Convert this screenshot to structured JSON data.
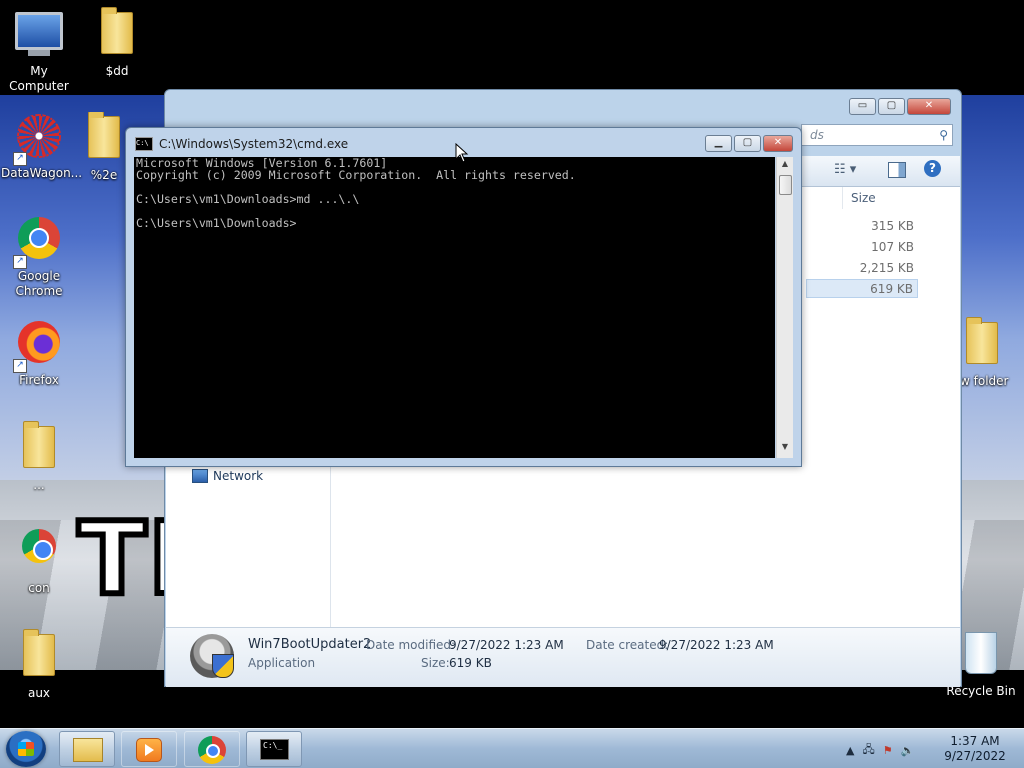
{
  "desktop": {
    "icons": [
      {
        "label": "My Computer"
      },
      {
        "label": "$dd"
      },
      {
        "label": "DataWagon..."
      },
      {
        "label": "%2e"
      },
      {
        "label": "Google Chrome"
      },
      {
        "label": "Firefox"
      },
      {
        "label": "..."
      },
      {
        "label": "con"
      },
      {
        "label": "aux"
      },
      {
        "label": "w folder"
      },
      {
        "label": "Recycle Bin"
      }
    ],
    "wallpaper_text": "TI"
  },
  "explorer": {
    "search_placeholder": "ds",
    "caption": {
      "minimize": "▭",
      "maximize": "▢",
      "close": "✕"
    },
    "size_column_header": "Size",
    "sizes": [
      "315 KB",
      "107 KB",
      "2,215 KB",
      "619 KB"
    ],
    "nav_network": "Network",
    "details": {
      "name": "Win7BootUpdater2",
      "type": "Application",
      "date_modified_label": "Date modified:",
      "date_modified": "9/27/2022 1:23 AM",
      "date_created_label": "Date created:",
      "date_created": "9/27/2022 1:23 AM",
      "size_label": "Size:",
      "size": "619 KB"
    }
  },
  "cmd": {
    "title": "C:\\Windows\\System32\\cmd.exe",
    "icon_text": "C:\\",
    "console_text": "Microsoft Windows [Version 6.1.7601]\nCopyright (c) 2009 Microsoft Corporation.  All rights reserved.\n\nC:\\Users\\vm1\\Downloads>md ...\\.\\\n\nC:\\Users\\vm1\\Downloads>",
    "caption": {
      "minimize": "▁",
      "maximize": "▢",
      "close": "✕"
    }
  },
  "taskbar": {
    "cmd_icon_text": "C:\\_",
    "clock_time": "1:37 AM",
    "clock_date": "9/27/2022"
  }
}
